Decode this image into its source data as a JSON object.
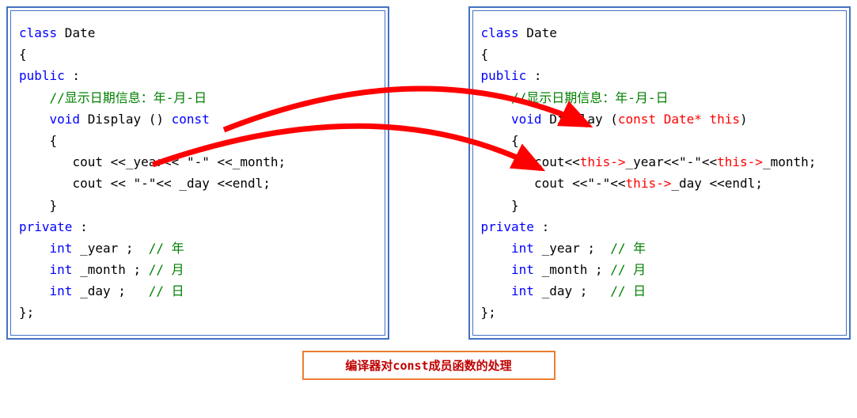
{
  "left": {
    "l1_kw": "class",
    "l1_name": " Date",
    "l2": "{",
    "l3_kw": "public",
    "l3_rest": " :",
    "l4_indent": "    ",
    "l4_comment": "//显示日期信息：年-月-日",
    "l5_indent": "    ",
    "l5_void": "void",
    "l5_display": " Display () ",
    "l5_const": "const",
    "l6": "    {",
    "l7_indent": "       ",
    "l7_cout": "cout ",
    "l7_chev1": "<<",
    "l7_year": "_year",
    "l7_chev2": "<< ",
    "l7_dash": "\"-\" ",
    "l7_chev3": "<<",
    "l7_month": "_month;",
    "l8_indent": "       ",
    "l8_cout": "cout ",
    "l8_chev1": "<< ",
    "l8_dash": "\"-\"",
    "l8_chev2": "<< ",
    "l8_day": "_day ",
    "l8_chev3": "<<",
    "l8_endl": "endl;",
    "l9": "    }",
    "l10_kw": "private",
    "l10_rest": " :",
    "l11_indent": "    ",
    "l11_int": "int",
    "l11_var": " _year ;  ",
    "l11_cmt": "// 年",
    "l12_indent": "    ",
    "l12_int": "int",
    "l12_var": " _month ; ",
    "l12_cmt": "// 月",
    "l13_indent": "    ",
    "l13_int": "int",
    "l13_var": " _day ;   ",
    "l13_cmt": "// 日",
    "l14": "};"
  },
  "right": {
    "l1_kw": "class",
    "l1_name": " Date",
    "l2": "{",
    "l3_kw": "public",
    "l3_rest": " :",
    "l4_indent": "    ",
    "l4_comment": "//显示日期信息：年-月-日",
    "l5_indent": "    ",
    "l5_void": "void",
    "l5_display": " Display (",
    "l5_const": "const Date* this",
    "l5_close": ")",
    "l6": "    {",
    "l7_indent": "       ",
    "l7_cout": "cout",
    "l7_chev1": "<<",
    "l7_this1": "this->",
    "l7_year": "_year",
    "l7_chev2": "<<",
    "l7_dash": "\"-\"",
    "l7_chev3": "<<",
    "l7_this2": "this->",
    "l7_month": "_month;",
    "l8_indent": "       ",
    "l8_cout": "cout ",
    "l8_chev1": "<<",
    "l8_dash": "\"-\"",
    "l8_chev2": "<<",
    "l8_this": "this->",
    "l8_day": "_day ",
    "l8_chev3": "<<",
    "l8_endl": "endl;",
    "l9": "    }",
    "l10_kw": "private",
    "l10_rest": " :",
    "l11_indent": "    ",
    "l11_int": "int",
    "l11_var": " _year ;  ",
    "l11_cmt": "// 年",
    "l12_indent": "    ",
    "l12_int": "int",
    "l12_var": " _month ; ",
    "l12_cmt": "// 月",
    "l13_indent": "    ",
    "l13_int": "int",
    "l13_var": " _day ;   ",
    "l13_cmt": "// 日",
    "l14": "};"
  },
  "caption": {
    "t1": "编译器对",
    "t2": "const",
    "t3": "成员函数的处理"
  }
}
